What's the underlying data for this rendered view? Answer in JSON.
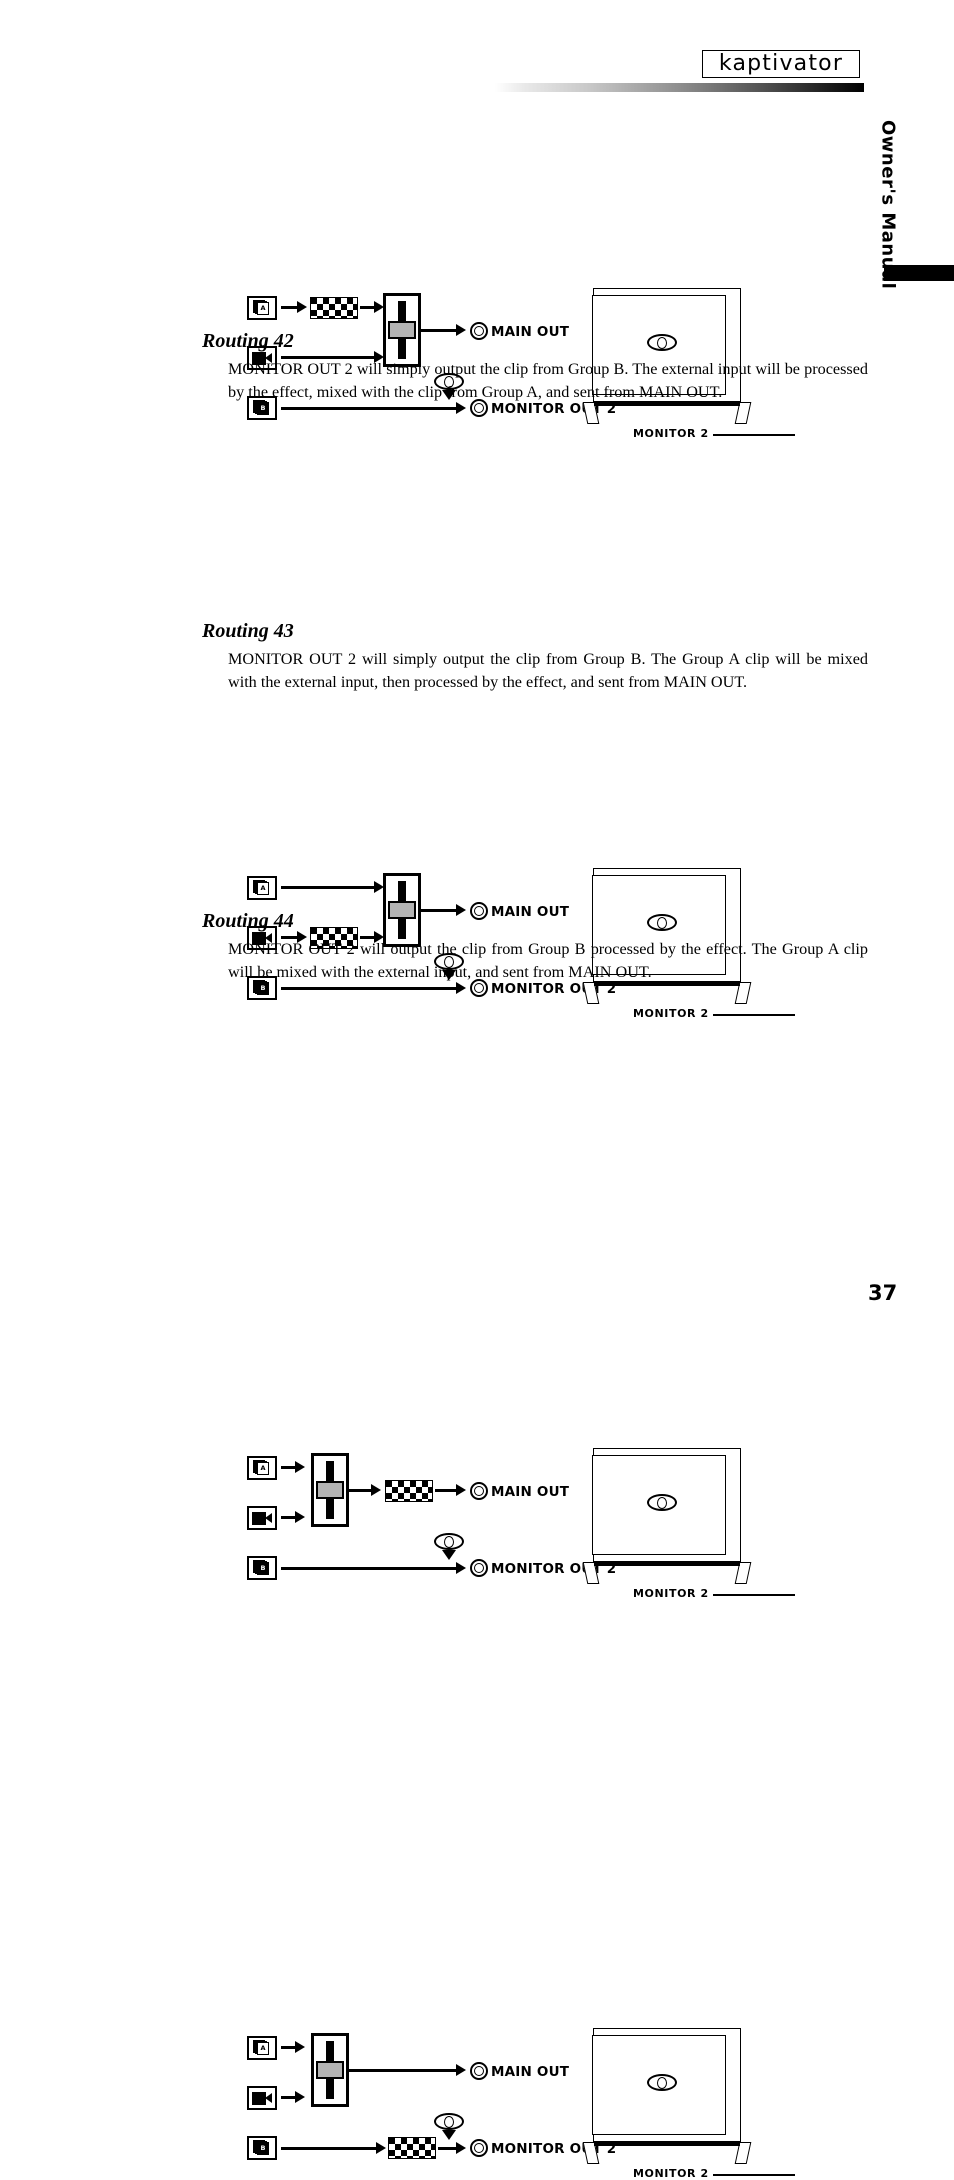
{
  "header": {
    "logo": "kaptivator",
    "side_label": "Owner's Manual"
  },
  "page": {
    "number": "37"
  },
  "sections": [
    {
      "heading": "Routing 42",
      "body": "MONITOR OUT 2 will simply output the clip from Group B. The external input will be processed by the effect, mixed with the clip from Group A, and sent from MAIN OUT."
    },
    {
      "heading": "Routing 43",
      "body": "MONITOR OUT 2 will simply output the clip from Group B. The Group A clip will be mixed with the external input, then processed by the effect, and sent from MAIN OUT."
    },
    {
      "heading": "Routing 44",
      "body": "MONITOR OUT 2 will output the clip from Group B processed by the effect. The Group A clip will be mixed with the external input, and sent from MAIN OUT."
    }
  ],
  "diagram_labels": {
    "main_out": "MAIN OUT",
    "monitor_out_2": "MONITOR OUT 2",
    "monitor_2": "MONITOR 2",
    "group_a": "A",
    "group_b": "B"
  },
  "diagrams": [
    {
      "id": "routing-41-diagram",
      "effect_position": "group-a-input",
      "caption_for": "above Routing 42"
    },
    {
      "id": "routing-42-diagram",
      "effect_position": "external-input"
    },
    {
      "id": "routing-43-diagram",
      "effect_position": "after-mixer-main-out"
    },
    {
      "id": "routing-44-diagram",
      "effect_position": "group-b-monitor-out"
    }
  ],
  "colors": {
    "ink": "#000000",
    "fader_knob": "#b3b3b3",
    "paper": "#ffffff"
  }
}
